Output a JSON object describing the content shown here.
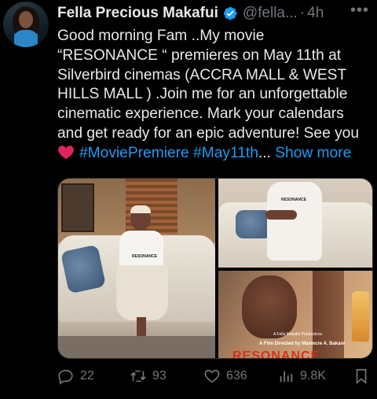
{
  "tweet": {
    "author_name": "Fella Precious Makafui",
    "handle": "@fella...",
    "separator": "·",
    "time": "4h",
    "more_icon": "more-horizontal-icon",
    "verified_icon": "verified-badge-icon",
    "text_lines": [
      "Good morning Fam ..My movie",
      "“RESONANCE “ premieres on May 11th at",
      "Silverbird cinemas (ACCRA MALL & WEST",
      "HILLS MALL ) .Join me for an unforgettable",
      "cinematic experience. Mark your calendars",
      "and get ready for an epic adventure! See you"
    ],
    "hashtag_1": "#MoviePremiere",
    "hashtag_2": "#May11th",
    "ellipsis": "...",
    "show_more": "Show more",
    "heart_emoji": "heart-emoji-icon",
    "media": {
      "poster_production": "A Fella Makafui Productions",
      "poster_credit": "A Film Directed by Maxmcre A. Bakare",
      "poster_title": "RESONANCE",
      "shirt_text": "RESONANCE"
    },
    "actions": {
      "replies": "22",
      "reposts": "93",
      "likes": "636",
      "views": "9.8K"
    },
    "colors": {
      "background": "#000000",
      "text": "#e7e9ea",
      "muted": "#71767b",
      "accent": "#1d9bf0",
      "verified": "#1d9bf0",
      "heart": "#e0245e"
    }
  }
}
